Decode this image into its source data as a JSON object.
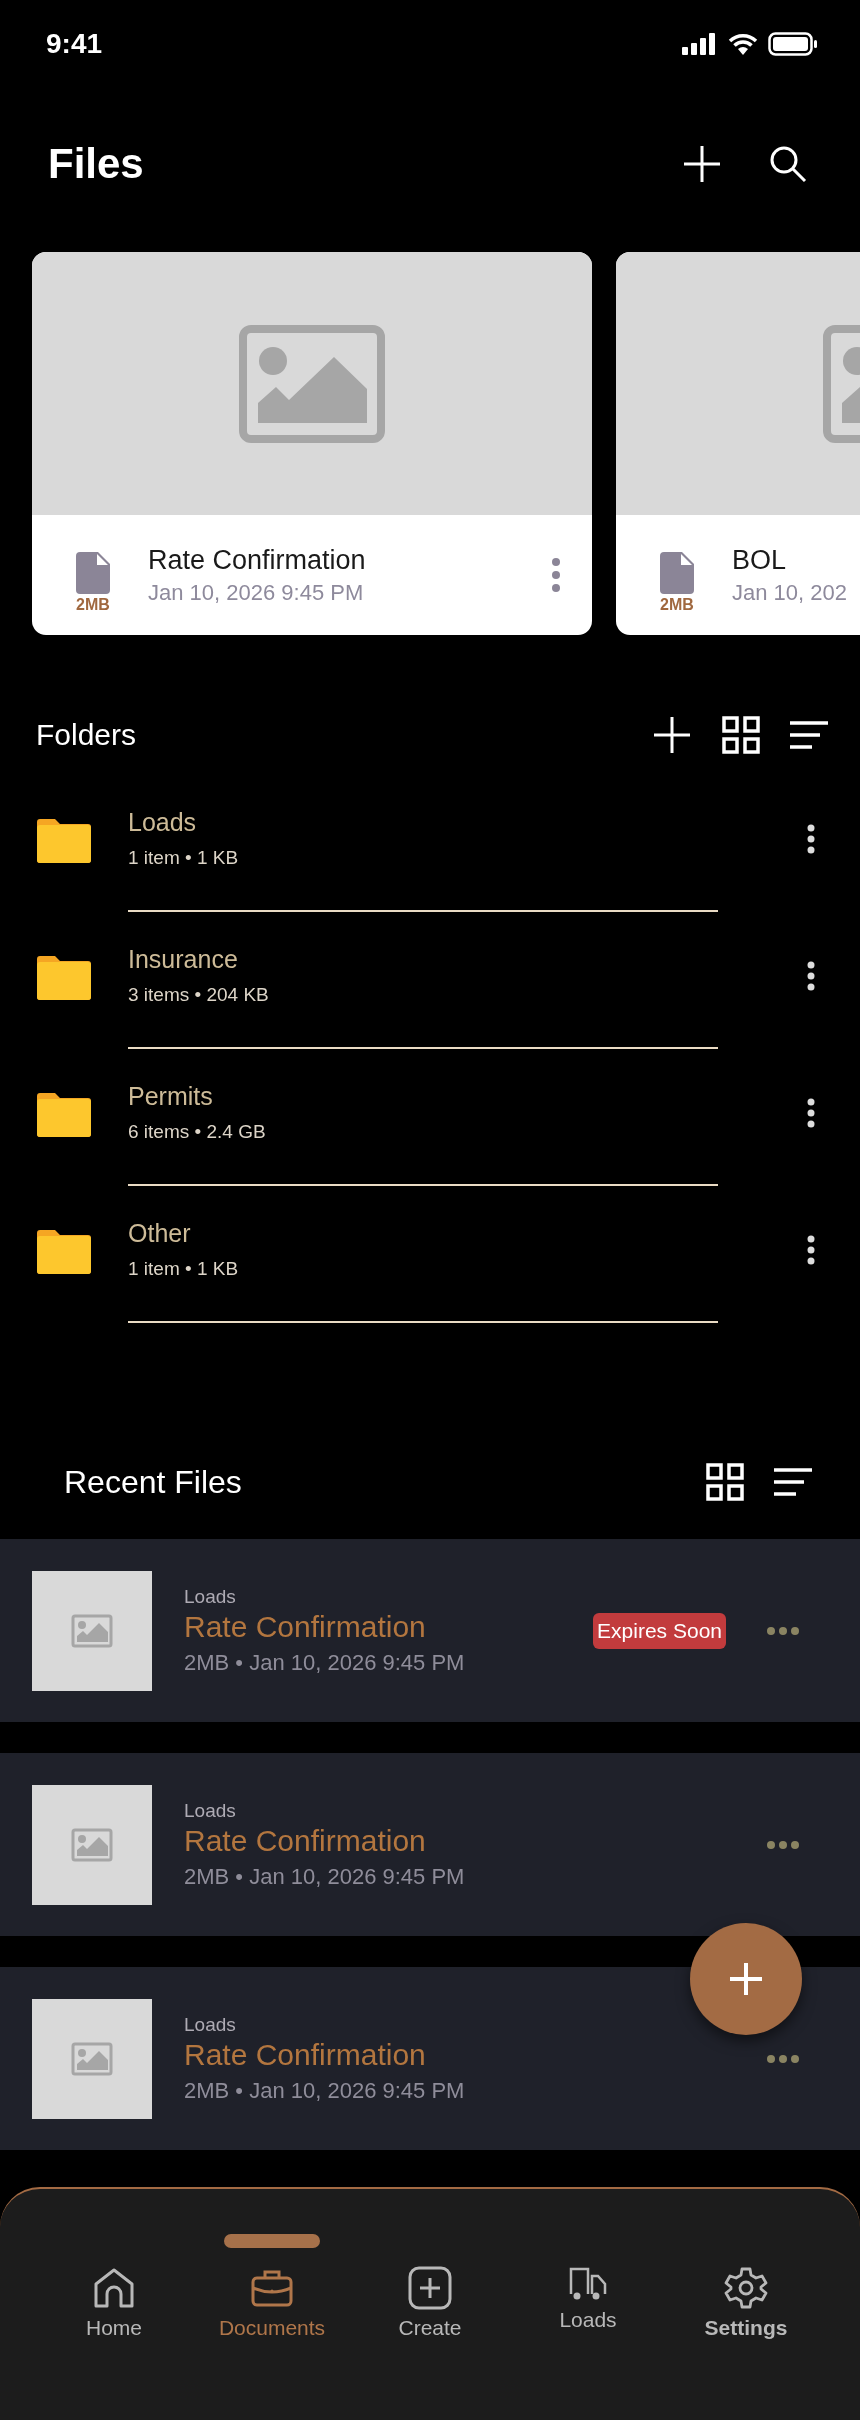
{
  "status_bar": {
    "time": "9:41"
  },
  "header": {
    "title": "Files"
  },
  "featured": [
    {
      "title": "Rate Confirmation",
      "date": "Jan 10, 2026 9:45 PM",
      "size": "2MB"
    },
    {
      "title": "BOL",
      "date": "Jan 10, 202",
      "size": "2MB"
    }
  ],
  "folders": {
    "title": "Folders",
    "items": [
      {
        "name": "Loads",
        "meta": "1 item • 1 KB"
      },
      {
        "name": "Insurance",
        "meta": "3 items • 204 KB"
      },
      {
        "name": "Permits",
        "meta": "6 items • 2.4 GB"
      },
      {
        "name": "Other",
        "meta": "1 item • 1 KB"
      }
    ]
  },
  "recent": {
    "title": "Recent Files",
    "items": [
      {
        "folder": "Loads",
        "name": "Rate Confirmation",
        "meta": "2MB • Jan 10, 2026 9:45 PM",
        "badge": "Expires Soon"
      },
      {
        "folder": "Loads",
        "name": "Rate Confirmation",
        "meta": "2MB • Jan 10, 2026 9:45 PM"
      },
      {
        "folder": "Loads",
        "name": "Rate Confirmation",
        "meta": "2MB • Jan 10, 2026 9:45 PM"
      }
    ]
  },
  "nav": [
    {
      "label": "Home",
      "selected": false,
      "bold": false
    },
    {
      "label": "Documents",
      "selected": true,
      "bold": false
    },
    {
      "label": "Create",
      "selected": false,
      "bold": false
    },
    {
      "label": "Loads",
      "selected": false,
      "bold": false
    },
    {
      "label": "Settings",
      "selected": false,
      "bold": true
    }
  ]
}
